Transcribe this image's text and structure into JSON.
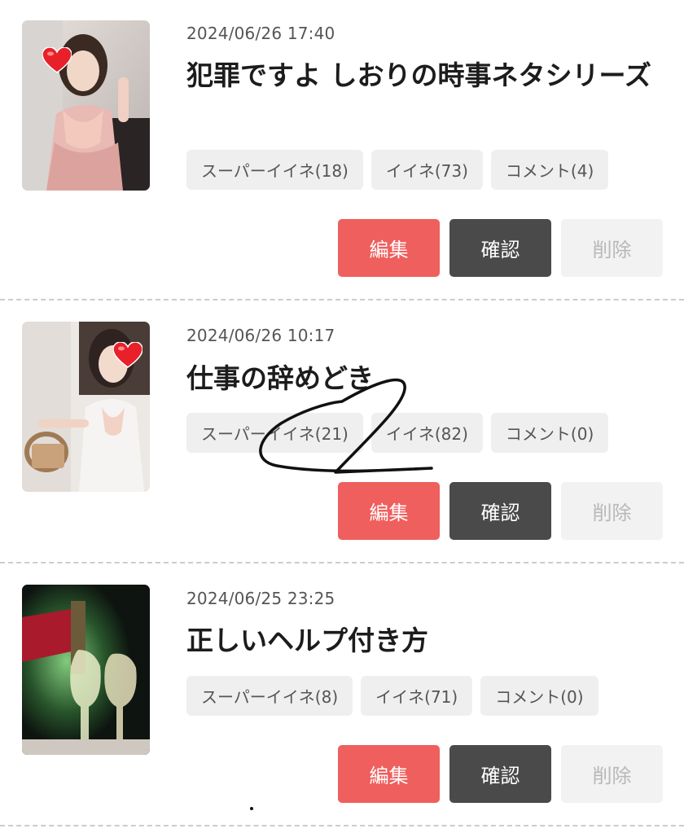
{
  "posts": [
    {
      "date": "2024/06/26 17:40",
      "title": "犯罪ですよ しおりの時事ネタシリーズ",
      "super_like": "スーパーイイネ(18)",
      "like": "イイネ(73)",
      "comment": "コメント(4)",
      "edit_label": "編集",
      "view_label": "確認",
      "delete_label": "削除"
    },
    {
      "date": "2024/06/26 10:17",
      "title": "仕事の辞めどき",
      "super_like": "スーパーイイネ(21)",
      "like": "イイネ(82)",
      "comment": "コメント(0)",
      "edit_label": "編集",
      "view_label": "確認",
      "delete_label": "削除"
    },
    {
      "date": "2024/06/25 23:25",
      "title": "正しいヘルプ付き方",
      "super_like": "スーパーイイネ(8)",
      "like": "イイネ(71)",
      "comment": "コメント(0)",
      "edit_label": "編集",
      "view_label": "確認",
      "delete_label": "削除"
    }
  ],
  "colors": {
    "edit_button": "#ef5f5d",
    "view_button": "#4a4a4a",
    "delete_button": "#f2f2f2",
    "tag_background": "#efefef",
    "heart_sticker": "#e8202a"
  },
  "icons": [
    "heart-sticker-icon"
  ]
}
